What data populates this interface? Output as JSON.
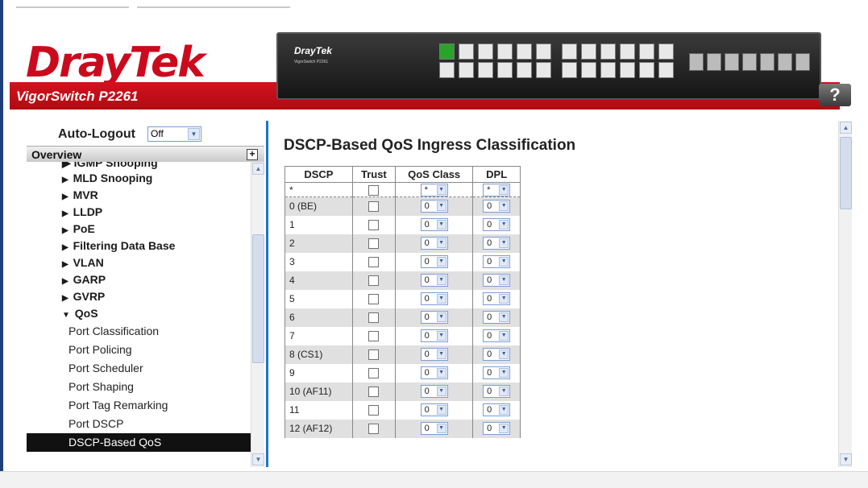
{
  "header": {
    "logo_main": "Dray",
    "logo_accent": "Tek",
    "model": "VigorSwitch P2261",
    "device_logo": "DrayTek",
    "device_sub": "VigorSwitch P2261",
    "help_label": "?"
  },
  "colors": {
    "brand_red": "#cc0a1e",
    "accent_blue": "#1e73c8",
    "active_bg": "#111111"
  },
  "autologout": {
    "label": "Auto-Logout",
    "value": "Off"
  },
  "overview": {
    "label": "Overview"
  },
  "sidebar": {
    "cut_item": "IGMP Snooping",
    "items": [
      {
        "label": "MLD Snooping"
      },
      {
        "label": "MVR"
      },
      {
        "label": "LLDP"
      },
      {
        "label": "PoE"
      },
      {
        "label": "Filtering Data Base"
      },
      {
        "label": "VLAN"
      },
      {
        "label": "GARP"
      },
      {
        "label": "GVRP"
      }
    ],
    "expanded": {
      "label": "QoS"
    },
    "subitems": [
      {
        "label": "Port Classification"
      },
      {
        "label": "Port Policing"
      },
      {
        "label": "Port Scheduler"
      },
      {
        "label": "Port Shaping"
      },
      {
        "label": "Port Tag Remarking"
      },
      {
        "label": "Port DSCP"
      },
      {
        "label": "DSCP-Based QoS"
      }
    ]
  },
  "main": {
    "title": "DSCP-Based QoS Ingress Classification",
    "columns": [
      "DSCP",
      "Trust",
      "QoS Class",
      "DPL"
    ],
    "wildcard": {
      "dscp": "*",
      "qos": "*",
      "dpl": "*"
    },
    "rows": [
      {
        "dscp": "0 (BE)",
        "qos": "0",
        "dpl": "0"
      },
      {
        "dscp": "1",
        "qos": "0",
        "dpl": "0"
      },
      {
        "dscp": "2",
        "qos": "0",
        "dpl": "0"
      },
      {
        "dscp": "3",
        "qos": "0",
        "dpl": "0"
      },
      {
        "dscp": "4",
        "qos": "0",
        "dpl": "0"
      },
      {
        "dscp": "5",
        "qos": "0",
        "dpl": "0"
      },
      {
        "dscp": "6",
        "qos": "0",
        "dpl": "0"
      },
      {
        "dscp": "7",
        "qos": "0",
        "dpl": "0"
      },
      {
        "dscp": "8 (CS1)",
        "qos": "0",
        "dpl": "0"
      },
      {
        "dscp": "9",
        "qos": "0",
        "dpl": "0"
      },
      {
        "dscp": "10 (AF11)",
        "qos": "0",
        "dpl": "0"
      },
      {
        "dscp": "11",
        "qos": "0",
        "dpl": "0"
      },
      {
        "dscp": "12 (AF12)",
        "qos": "0",
        "dpl": "0"
      }
    ]
  }
}
